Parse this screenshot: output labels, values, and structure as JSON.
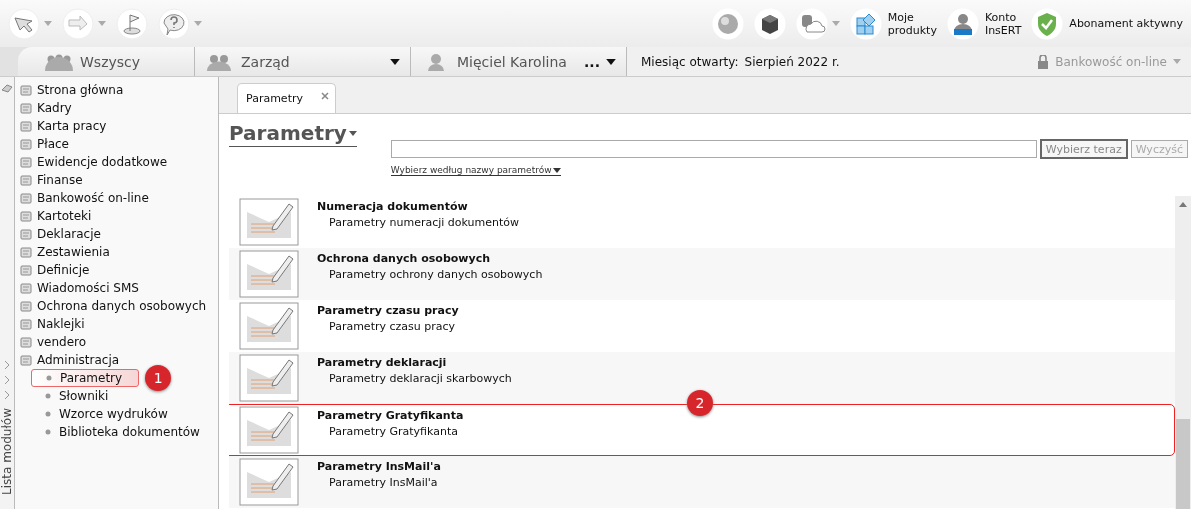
{
  "toolbar": {
    "left_buttons": [
      {
        "kind": "cursor",
        "has_menu": true
      },
      {
        "kind": "arrow",
        "has_menu": true
      },
      {
        "kind": "flag",
        "has_menu": false
      },
      {
        "kind": "help",
        "has_menu": true
      }
    ],
    "right_buttons": [
      {
        "kind": "globe",
        "has_menu": false
      },
      {
        "kind": "cube",
        "has_menu": false
      },
      {
        "kind": "cloud",
        "has_menu": true
      },
      {
        "kind": "products",
        "lines": [
          "Moje",
          "produkty"
        ],
        "has_menu": false
      },
      {
        "kind": "account",
        "lines": [
          "Konto",
          "InsERT"
        ],
        "has_menu": false
      },
      {
        "kind": "shield",
        "lines": [
          "Abonament aktywny"
        ],
        "has_menu": false
      }
    ]
  },
  "context_bar": {
    "groups": [
      {
        "kind": "all",
        "label": "Wszyscy",
        "has_menu": false
      },
      {
        "kind": "group",
        "label": "Zarząd",
        "has_menu": true
      },
      {
        "kind": "person",
        "label": "Mięciel Karolina",
        "has_menu": true,
        "more": "..."
      }
    ],
    "month_label": "Miesiąc otwarty:",
    "month_value": "Sierpień 2022 r.",
    "module": {
      "label": "Bankowość on-line",
      "disabled": true
    }
  },
  "sidebar": {
    "rail_label": "Lista modułów",
    "items": [
      {
        "label": "Strona główna"
      },
      {
        "label": "Kadry"
      },
      {
        "label": "Karta pracy"
      },
      {
        "label": "Płace"
      },
      {
        "label": "Ewidencje dodatkowe"
      },
      {
        "label": "Finanse"
      },
      {
        "label": "Bankowość on-line"
      },
      {
        "label": "Kartoteki"
      },
      {
        "label": "Deklaracje"
      },
      {
        "label": "Zestawienia"
      },
      {
        "label": "Definicje"
      },
      {
        "label": "Wiadomości SMS"
      },
      {
        "label": "Ochrona danych osobowych"
      },
      {
        "label": "Naklejki"
      },
      {
        "label": "vendero"
      },
      {
        "label": "Administracja",
        "children": [
          {
            "label": "Parametry",
            "selected": true,
            "callout": "1"
          },
          {
            "label": "Słowniki",
            "selected": false
          },
          {
            "label": "Wzorce wydruków",
            "selected": false
          },
          {
            "label": "Biblioteka dokumentów",
            "selected": false
          }
        ]
      }
    ]
  },
  "content": {
    "tabs": [
      {
        "label": "Parametry",
        "selected": true
      }
    ],
    "heading": "Parametry",
    "list_callout": "2",
    "search": {
      "buttons": [
        {
          "label": "Wybierz teraz",
          "disabled": false
        },
        {
          "label": "Wyczyść",
          "disabled": true
        }
      ],
      "filter_link": "Wybierz według nazwy parametrów"
    },
    "rows": [
      {
        "title": "Numeracja dokumentów",
        "subtitle": "Parametry numeracji dokumentów",
        "highlighted": false
      },
      {
        "title": "Ochrona danych osobowych",
        "subtitle": "Parametry ochrony danych osobowych",
        "highlighted": false
      },
      {
        "title": "Parametry czasu pracy",
        "subtitle": "Parametry czasu pracy",
        "highlighted": false
      },
      {
        "title": "Parametry deklaracji",
        "subtitle": "Parametry deklaracji skarbowych",
        "highlighted": false
      },
      {
        "title": "Parametry Gratyfikanta",
        "subtitle": "Parametry Gratyfikanta",
        "highlighted": true
      },
      {
        "title": "Parametry InsMail'a",
        "subtitle": "Parametry InsMail'a",
        "highlighted": false
      }
    ]
  }
}
